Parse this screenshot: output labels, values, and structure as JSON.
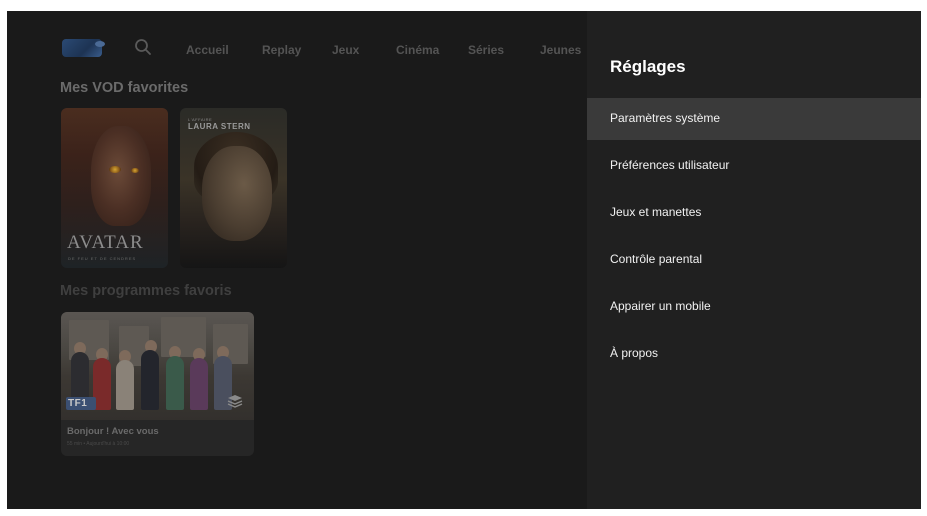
{
  "nav": {
    "items": [
      {
        "label": "Accueil"
      },
      {
        "label": "Replay"
      },
      {
        "label": "Jeux"
      },
      {
        "label": "Cinéma"
      },
      {
        "label": "Séries"
      },
      {
        "label": "Jeunes"
      }
    ]
  },
  "vod": {
    "title": "Mes VOD favorites",
    "posters": [
      {
        "title": "AVATAR",
        "subtitle": "DE FEU ET DE CENDRES"
      },
      {
        "kicker": "L'AFFAIRE",
        "title": "LAURA STERN"
      }
    ]
  },
  "programmes": {
    "title": "Mes programmes favoris",
    "cards": [
      {
        "channel": "TF1",
        "title": "Bonjour ! Avec vous",
        "meta": "55 min • Aujourd'hui à 10:00"
      }
    ]
  },
  "settings": {
    "title": "Réglages",
    "items": [
      {
        "label": "Paramètres système",
        "selected": true
      },
      {
        "label": "Préférences utilisateur"
      },
      {
        "label": "Jeux et manettes"
      },
      {
        "label": "Contrôle parental"
      },
      {
        "label": "Appairer un mobile"
      },
      {
        "label": "À propos"
      }
    ]
  },
  "colors": {
    "background": "#1a1a1a",
    "panel": "#202020",
    "selected": "#3a3a3a",
    "text": "#ffffff"
  }
}
